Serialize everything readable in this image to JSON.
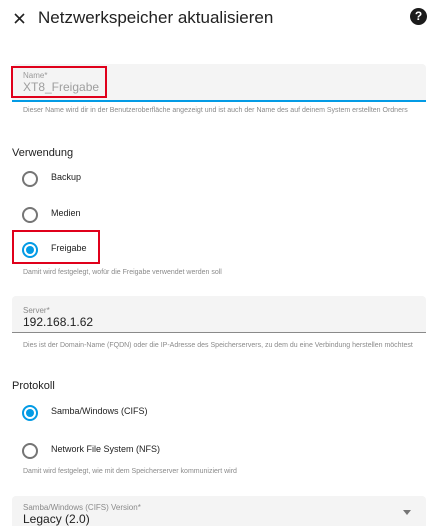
{
  "header": {
    "title": "Netzwerkspeicher aktualisieren",
    "close_icon": "close-icon",
    "help_icon": "help-icon",
    "help_glyph": "?"
  },
  "name_field": {
    "label": "Name*",
    "value": "XT8_Freigabe",
    "helper": "Dieser Name wird dir in der Benutzeroberfläche angezeigt und ist auch der Name des auf deinem System erstellten Ordners"
  },
  "usage": {
    "title": "Verwendung",
    "options": [
      {
        "label": "Backup",
        "checked": false
      },
      {
        "label": "Medien",
        "checked": false
      },
      {
        "label": "Freigabe",
        "checked": true
      }
    ],
    "helper": "Damit wird festgelegt, wofür die Freigabe verwendet werden soll"
  },
  "server_field": {
    "label": "Server*",
    "value": "192.168.1.62",
    "helper": "Dies ist der Domain-Name (FQDN) oder die IP-Adresse des Speicherservers, zu dem du eine Verbindung herstellen möchtest"
  },
  "protocol": {
    "title": "Protokoll",
    "options": [
      {
        "label": "Samba/Windows (CIFS)",
        "checked": true
      },
      {
        "label": "Network File System (NFS)",
        "checked": false
      }
    ],
    "helper": "Damit wird festgelegt, wie mit dem Speicherserver kommuniziert wird"
  },
  "version_field": {
    "label": "Samba/Windows (CIFS) Version*",
    "value": "Legacy (2.0)"
  },
  "colors": {
    "accent": "#039be5",
    "highlight": "#e0001b"
  }
}
